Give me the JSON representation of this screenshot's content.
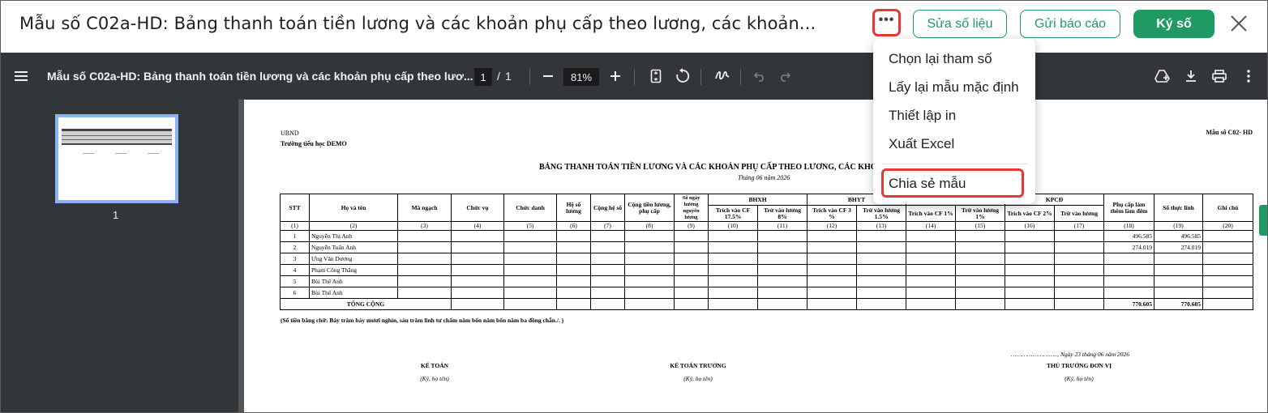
{
  "header": {
    "title": "Mẫu số C02a-HD: Bảng thanh toán tiền lương và các khoản phụ cấp theo lương, các khoản...",
    "more_label": "•••",
    "edit_label": "Sửa số liệu",
    "send_label": "Gửi báo cáo",
    "sign_label": "Ký số"
  },
  "menu": {
    "items": [
      {
        "label": "Chọn lại tham số"
      },
      {
        "label": "Lấy lại mẫu mặc định"
      },
      {
        "label": "Thiết lập in"
      },
      {
        "label": "Xuất Excel"
      },
      {
        "label": "Chia sẻ mẫu"
      }
    ]
  },
  "viewer": {
    "doc_title": "Mẫu số C02a-HD: Bảng thanh toán tiền lương và các khoản phụ cấp theo lươ...",
    "page_current": "1",
    "page_separator": "/",
    "page_total": "1",
    "zoom": "81%",
    "thumb_label": "1"
  },
  "document": {
    "org": "UBND",
    "school": "Trường tiểu học DEMO",
    "form_no": "Mẫu số C02- HD",
    "heading": "BẢNG THANH TOÁN TIỀN LƯƠNG VÀ CÁC KHOẢN PHỤ CẤP THEO LƯƠNG, CÁC KHO",
    "month": "Tháng 06 năm 2026",
    "headers": {
      "stt": "STT",
      "name": "Họ và tên",
      "rank": "Mã ngạch",
      "position": "Chức vụ",
      "title": "Chức danh",
      "coef": "Hệ số lương",
      "coef_add": "Cộng hệ số",
      "salary_sum": "Cộng tiền lương, phụ cấp",
      "days": "Số ngày hưởng nguyên lương",
      "bhxh": "BHXH",
      "bhyt": "BHYT",
      "kpcd": "KPCĐ",
      "bhxh_cf": "Trích vào CF 17.5%",
      "bhxh_deduct": "Trừ vào lương 8%",
      "bhyt_cf": "Trích vào CF 3 %",
      "bhyt_deduct": "Trừ vào lương 1.5%",
      "bhtn_cf": "Trích vào CF 1%",
      "bhtn_deduct": "Trừ vào lương 1%",
      "kpcd_cf": "Trích vào CF 2%",
      "kpcd_deduct": "Trừ vào lương",
      "night": "Phụ cấp làm thêm làm đêm",
      "net": "Số thực lĩnh",
      "note": "Ghi chú"
    },
    "index_row": [
      "(1)",
      "(2)",
      "(3)",
      "(4)",
      "(5)",
      "(6)",
      "(7)",
      "(8)",
      "(9)",
      "(10)",
      "(11)",
      "(12)",
      "(13)",
      "(14)",
      "(15)",
      "(16)",
      "(17)",
      "(18)",
      "(19)",
      "(20)"
    ],
    "rows": [
      {
        "stt": "1",
        "name": "Nguyễn Thị Anh",
        "night": "496.585",
        "net": "496.585"
      },
      {
        "stt": "2",
        "name": "Nguyễn Tuấn Anh",
        "night": "274.019",
        "net": "274.019"
      },
      {
        "stt": "3",
        "name": "Ưng Văn Dương",
        "night": "",
        "net": ""
      },
      {
        "stt": "4",
        "name": "Phạm Công Thắng",
        "night": "",
        "net": ""
      },
      {
        "stt": "5",
        "name": "Bùi Thế Anh",
        "night": "",
        "net": ""
      },
      {
        "stt": "6",
        "name": "Bùi Thế Anh",
        "night": "",
        "net": ""
      }
    ],
    "total": {
      "label": "TỔNG CỘNG",
      "night": "770.605",
      "net": "770.605"
    },
    "amount_words": "(Số tiền bằng chữ: Bảy trăm bảy mươi nghìn, sáu trăm linh tư chấm năm bốn năm bốn năm ba đồng chẵn./. )",
    "sign_date": "…………………….., Ngày 23 tháng 06 năm 2026",
    "signers": [
      {
        "title": "KẾ TOÁN",
        "sub": "(Ký, họ tên)"
      },
      {
        "title": "KẾ TOÁN TRƯỞNG",
        "sub": "(Ký, họ tên)"
      },
      {
        "title": "THỦ TRƯỞNG ĐƠN VỊ",
        "sub": "(Ký, họ tên)"
      }
    ]
  },
  "colors": {
    "accent_green": "#1e9a62",
    "highlight_red": "#e53935",
    "viewer_toolbar": "#323639"
  }
}
